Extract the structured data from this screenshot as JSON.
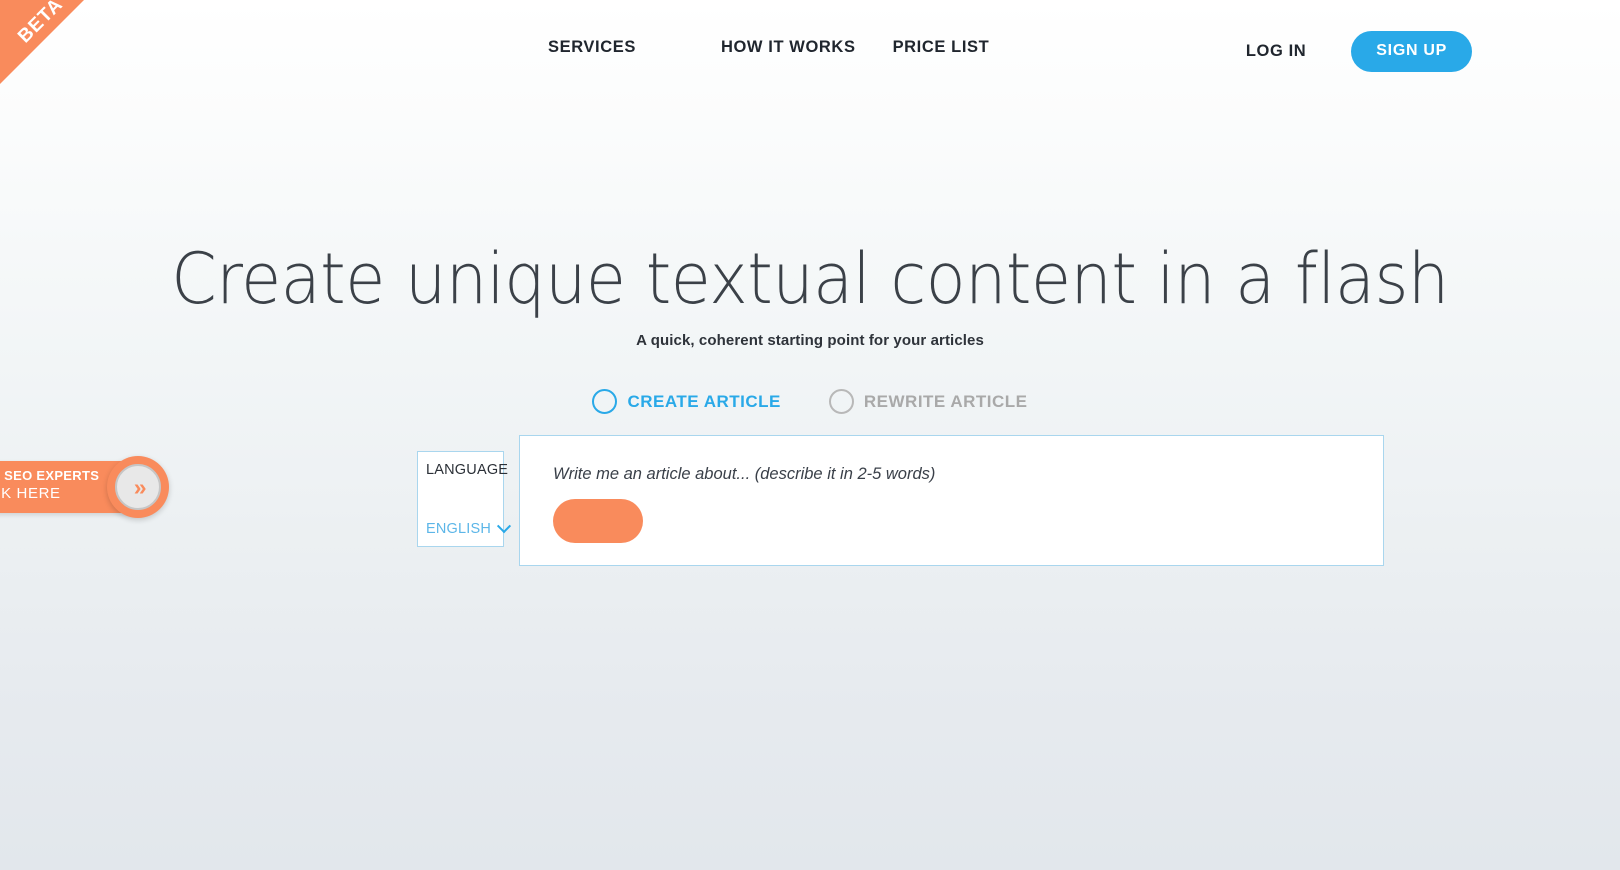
{
  "ribbon": {
    "label": "BETA"
  },
  "header": {
    "nav": [
      {
        "label": "SERVICES",
        "name": "nav-link-services"
      },
      {
        "label": "HOW IT WORKS",
        "name": "nav-link-how-it-works"
      },
      {
        "label": "PRICE LIST",
        "name": "nav-link-price-list"
      }
    ],
    "login_label": "LOG IN",
    "signup_label": "SIGN UP"
  },
  "hero": {
    "title": "Create unique textual content in a flash",
    "subtitle": "A quick, coherent starting point for your articles"
  },
  "modes": [
    {
      "label": "CREATE ARTICLE",
      "selected": true
    },
    {
      "label": "REWRITE ARTICLE",
      "selected": false
    }
  ],
  "form": {
    "language": {
      "label": "LANGUAGE",
      "value": "ENGLISH",
      "options": [
        "ENGLISH"
      ]
    },
    "prompt": {
      "placeholder": "Write me an article about... (describe it in 2-5 words)",
      "value": ""
    },
    "generate_label": ""
  },
  "side_promo": {
    "line1": "GENCIES & SEO EXPERTS",
    "line2": "CLICK HERE",
    "icon": "chevrons-right-icon",
    "glyph": "»"
  },
  "colors": {
    "accent_blue": "#29a9e8",
    "accent_orange": "#f98b5c",
    "text_dark": "#20262e",
    "muted_gray": "#a9a9a9",
    "border_blue": "#a9d6ee"
  }
}
